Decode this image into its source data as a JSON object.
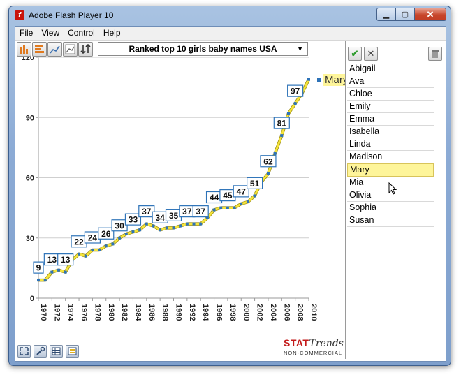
{
  "window": {
    "title": "Adobe Flash Player 10"
  },
  "menu": [
    "File",
    "View",
    "Control",
    "Help"
  ],
  "toolbar": {
    "dataset_selected": "Ranked top 10 girls baby names USA"
  },
  "legend": {
    "label": "Mary"
  },
  "names": [
    "Abigail",
    "Ava",
    "Chloe",
    "Emily",
    "Emma",
    "Isabella",
    "Linda",
    "Madison",
    "Mary",
    "Mia",
    "Olivia",
    "Sophia",
    "Susan"
  ],
  "selected_name": "Mary",
  "logo": {
    "brand_bold": "STAT",
    "brand_script": "Trends",
    "subtitle": "NON-COMMERCIAL"
  },
  "colors": {
    "line_fill": "#f5e43a",
    "marker": "#2e73b8",
    "label_border": "#2e73b8",
    "selected_bg": "#fef59a"
  },
  "chart_data": {
    "type": "line",
    "series": [
      {
        "name": "Mary",
        "x": [
          1970,
          1971,
          1972,
          1973,
          1974,
          1975,
          1976,
          1977,
          1978,
          1979,
          1980,
          1981,
          1982,
          1983,
          1984,
          1985,
          1986,
          1987,
          1988,
          1989,
          1990,
          1991,
          1992,
          1993,
          1994,
          1995,
          1996,
          1997,
          1998,
          1999,
          2000,
          2001,
          2002,
          2003,
          2004,
          2005,
          2006,
          2007,
          2008,
          2009,
          2010
        ],
        "values": [
          9,
          9,
          13,
          14,
          13,
          19,
          22,
          21,
          24,
          24,
          26,
          27,
          30,
          32,
          33,
          34,
          37,
          36,
          34,
          35,
          35,
          36,
          37,
          37,
          37,
          40,
          44,
          45,
          45,
          45,
          47,
          48,
          51,
          58,
          62,
          72,
          81,
          92,
          97,
          102,
          109
        ]
      }
    ],
    "labels": [
      {
        "year": 1970,
        "text": "9"
      },
      {
        "year": 1972,
        "text": "13"
      },
      {
        "year": 1974,
        "text": "13"
      },
      {
        "year": 1976,
        "text": "22"
      },
      {
        "year": 1978,
        "text": "24"
      },
      {
        "year": 1980,
        "text": "26"
      },
      {
        "year": 1982,
        "text": "30"
      },
      {
        "year": 1984,
        "text": "33"
      },
      {
        "year": 1986,
        "text": "37"
      },
      {
        "year": 1988,
        "text": "34"
      },
      {
        "year": 1990,
        "text": "35"
      },
      {
        "year": 1992,
        "text": "37"
      },
      {
        "year": 1994,
        "text": "37"
      },
      {
        "year": 1996,
        "text": "44"
      },
      {
        "year": 1998,
        "text": "45"
      },
      {
        "year": 2000,
        "text": "47"
      },
      {
        "year": 2002,
        "text": "51"
      },
      {
        "year": 2004,
        "text": "62"
      },
      {
        "year": 2006,
        "text": "81"
      },
      {
        "year": 2008,
        "text": "97"
      }
    ],
    "x_ticks": [
      "1970",
      "1972",
      "1974",
      "1976",
      "1978",
      "1980",
      "1982",
      "1984",
      "1986",
      "1988",
      "1990",
      "1992",
      "1994",
      "1996",
      "1998",
      "2000",
      "2002",
      "2004",
      "2006",
      "2008",
      "2010"
    ],
    "y_ticks": [
      "0",
      "30",
      "60",
      "90",
      "120"
    ],
    "ylim": [
      0,
      120
    ],
    "xlim": [
      1970,
      2010
    ],
    "grid": true
  }
}
